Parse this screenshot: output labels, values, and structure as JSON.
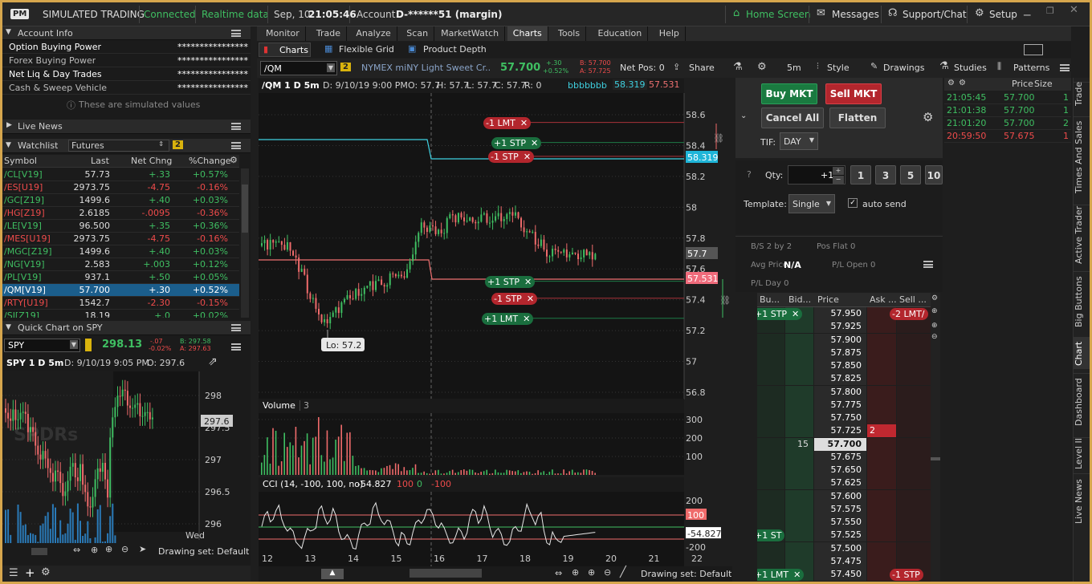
{
  "topbar": {
    "logo": "PM",
    "title": "SIMULATED TRADING",
    "connected": "Connected",
    "realtime": "Realtime data",
    "date": "Sep, 10",
    "time": "21:05:46",
    "account_label": "Account:",
    "account": "D-******51 (margin)",
    "home": "Home Screen",
    "messages": "Messages",
    "support": "Support/Chat",
    "setup": "Setup"
  },
  "account_info": {
    "title": "Account Info",
    "rows": [
      {
        "label": "Option Buying Power",
        "value": "****************"
      },
      {
        "label": "Forex Buying Power",
        "value": "****************"
      },
      {
        "label": "Net Liq & Day Trades",
        "value": "****************"
      },
      {
        "label": "Cash & Sweep Vehicle",
        "value": "****************"
      }
    ],
    "note": "These are simulated values"
  },
  "live_news": {
    "title": "Live News"
  },
  "watchlist": {
    "title": "Watchlist",
    "list": "Futures",
    "badge": "2",
    "headers": [
      "Symbol",
      "Last",
      "Net Chng",
      "%Change"
    ],
    "rows": [
      {
        "sym": "/CL[V19]",
        "last": "57.73",
        "chg": "+.33",
        "pct": "+0.57%",
        "dir": "up"
      },
      {
        "sym": "/ES[U19]",
        "last": "2973.75",
        "chg": "-4.75",
        "pct": "-0.16%",
        "dir": "down"
      },
      {
        "sym": "/GC[Z19]",
        "last": "1499.6",
        "chg": "+.40",
        "pct": "+0.03%",
        "dir": "up"
      },
      {
        "sym": "/HG[Z19]",
        "last": "2.6185",
        "chg": "-.0095",
        "pct": "-0.36%",
        "dir": "down"
      },
      {
        "sym": "/LE[V19]",
        "last": "96.500",
        "chg": "+.35",
        "pct": "+0.36%",
        "dir": "up"
      },
      {
        "sym": "/MES[U19]",
        "last": "2973.75",
        "chg": "-4.75",
        "pct": "-0.16%",
        "dir": "down"
      },
      {
        "sym": "/MGC[Z19]",
        "last": "1499.6",
        "chg": "+.40",
        "pct": "+0.03%",
        "dir": "up"
      },
      {
        "sym": "/NG[V19]",
        "last": "2.583",
        "chg": "+.003",
        "pct": "+0.12%",
        "dir": "up"
      },
      {
        "sym": "/PL[V19]",
        "last": "937.1",
        "chg": "+.50",
        "pct": "+0.05%",
        "dir": "up"
      },
      {
        "sym": "/QM[V19]",
        "last": "57.700",
        "chg": "+.30",
        "pct": "+0.52%",
        "dir": "sel"
      },
      {
        "sym": "/RTY[U19]",
        "last": "1542.7",
        "chg": "-2.30",
        "pct": "-0.15%",
        "dir": "down"
      },
      {
        "sym": "/SI[Z19]",
        "last": "18.19",
        "chg": "+.0",
        "pct": "+0.02%",
        "dir": "up"
      }
    ]
  },
  "quick_chart": {
    "title": "Quick Chart on SPY",
    "symbol": "SPY",
    "price": "298.13",
    "chg": "-.07",
    "pct": "-0.02%",
    "bid": "B: 297.58",
    "ask": "A: 297.63",
    "desc": "SPY 1 D 5m",
    "date": "D: 9/10/19 9:05 PM",
    "open": "O: 297.6",
    "last_tag": "297.6",
    "yticks": [
      "298",
      "297.5",
      "297",
      "296.5",
      "296"
    ],
    "xlabel": "Wed",
    "watermark": "SPDRs",
    "drawing_set": "Drawing set: Default"
  },
  "menu": {
    "items": [
      "Monitor",
      "Trade",
      "Analyze",
      "Scan",
      "MarketWatch",
      "Charts",
      "Tools",
      "Education",
      "Help"
    ],
    "active": "Charts"
  },
  "subtabs": {
    "charts": "Charts",
    "flex": "Flexible Grid",
    "depth": "Product Depth"
  },
  "chart_toolbar": {
    "symbol": "/QM",
    "badge": "2",
    "desc": "NYMEX miNY Light Sweet Cr...",
    "price": "57.700",
    "chg": "+.30",
    "pct": "+0.52%",
    "bid": "B: 57.700",
    "ask": "A: 57.725",
    "netpos": "Net Pos: 0",
    "share": "Share",
    "interval": "5m",
    "style": "Style",
    "drawings": "Drawings",
    "studies": "Studies",
    "patterns": "Patterns"
  },
  "chart_header": {
    "sym": "/QM 1 D 5m",
    "date": "D: 9/10/19 9:00 PM",
    "open": "O: 57.7",
    "high": "H: 57.7",
    "low": "L: 57.7",
    "close": "C: 57.7",
    "r": "R: 0",
    "bbb": "bbbbbbb",
    "val1": "58.319",
    "val2": "57.531"
  },
  "chart_data": {
    "type": "line",
    "yticks": [
      "58.6",
      "58.4",
      "58.2",
      "58",
      "57.8",
      "57.6",
      "57.4",
      "57.2",
      "57",
      "56.8"
    ],
    "xticks": [
      "12",
      "13",
      "14",
      "15",
      "16",
      "17",
      "18",
      "19",
      "20",
      "21",
      "22"
    ],
    "last": "57.7",
    "upper": "58.319",
    "lower": "57.531",
    "low_label": "Lo: 57.2",
    "orders": [
      {
        "label": "-1 LMT",
        "price": 58.55,
        "kind": "l"
      },
      {
        "label": "+1 STP",
        "price": 58.42,
        "kind": "s"
      },
      {
        "label": "-1 STP",
        "price": 58.33,
        "kind": "l"
      },
      {
        "label": "+1 STP",
        "price": 57.52,
        "kind": "s"
      },
      {
        "label": "-1 STP",
        "price": 57.41,
        "kind": "l"
      },
      {
        "label": "+1 LMT",
        "price": 57.28,
        "kind": "s"
      }
    ]
  },
  "volume": {
    "title": "Volume",
    "badge": "3",
    "yticks": [
      "300",
      "200",
      "100"
    ]
  },
  "cci": {
    "title": "CCI (14, -100, 100, no)",
    "val": "-54.827",
    "p100": "100",
    "p0": "0",
    "m100": "-100",
    "yticks": [
      "200",
      "100",
      "-200"
    ],
    "tag100": "100",
    "tagval": "-54.827"
  },
  "bottom": {
    "drawing_set": "Drawing set: Default"
  },
  "active_trader": {
    "buy": "Buy MKT",
    "sell": "Sell MKT",
    "cancel": "Cancel All",
    "flatten": "Flatten",
    "tif_label": "TIF:",
    "tif": "DAY",
    "qty_label": "Qty:",
    "qty": "+1",
    "quick": [
      "1",
      "3",
      "5",
      "10"
    ],
    "template_label": "Template:",
    "template": "Single",
    "auto": "auto send",
    "bs": "B/S 2 by 2",
    "posflat": "Pos Flat 0",
    "avg_label": "Avg Price",
    "avg": "N/A",
    "pl_open": "P/L Open 0",
    "pl_day": "P/L Day 0",
    "ladder_headers": [
      "Bu...",
      "Bid...",
      "Price",
      "Ask ...",
      "Sell ..."
    ],
    "ladder": [
      {
        "price": "57.950",
        "buy": "+1 STP",
        "sell": "-2 LMT/"
      },
      {
        "price": "57.925"
      },
      {
        "price": "57.900"
      },
      {
        "price": "57.875"
      },
      {
        "price": "57.850"
      },
      {
        "price": "57.825"
      },
      {
        "price": "57.800"
      },
      {
        "price": "57.775"
      },
      {
        "price": "57.750"
      },
      {
        "price": "57.725",
        "ask": "2"
      },
      {
        "price": "57.700",
        "bid": "15"
      },
      {
        "price": "57.675"
      },
      {
        "price": "57.650"
      },
      {
        "price": "57.625"
      },
      {
        "price": "57.600"
      },
      {
        "price": "57.575"
      },
      {
        "price": "57.550"
      },
      {
        "price": "57.525",
        "buy": "+1 ST"
      },
      {
        "price": "57.500"
      },
      {
        "price": "57.475"
      },
      {
        "price": "57.450",
        "buy": "+1 LMT",
        "sell": "-1 STP"
      }
    ]
  },
  "tns": {
    "headers": [
      "Price",
      "Size"
    ],
    "rows": [
      {
        "time": "21:05:45",
        "price": "57.700",
        "size": "1",
        "dir": "up"
      },
      {
        "time": "21:01:38",
        "price": "57.700",
        "size": "1",
        "dir": "up"
      },
      {
        "time": "21:01:20",
        "price": "57.700",
        "size": "2",
        "dir": "up"
      },
      {
        "time": "20:59:50",
        "price": "57.675",
        "size": "1",
        "dir": "down"
      }
    ]
  },
  "sidetabs": [
    "Trade",
    "Times And Sales",
    "Active Trader",
    "Big Buttons",
    "Chart",
    "Dashboard",
    "Level II",
    "Live News"
  ]
}
